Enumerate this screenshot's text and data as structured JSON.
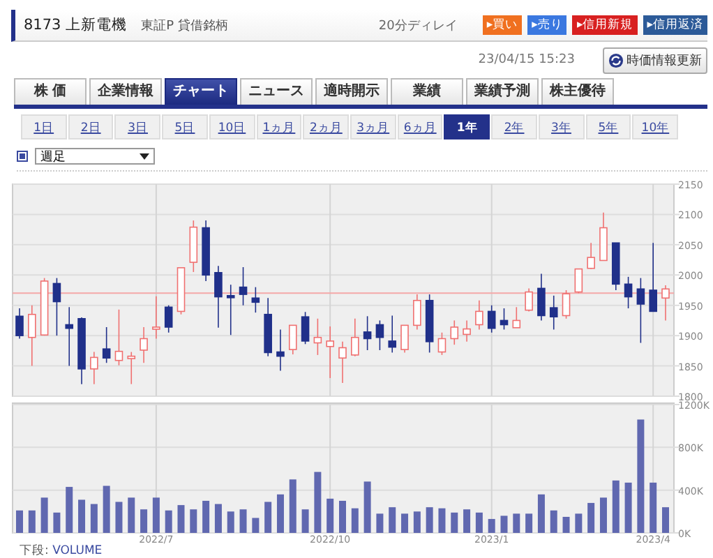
{
  "header": {
    "code": "8173",
    "name": "上新電機",
    "market": "東証P 貸借銘柄",
    "delay": "20分ディレイ",
    "buttons": [
      {
        "label": "▸買い",
        "color": "#f07020"
      },
      {
        "label": "▸売り",
        "color": "#3a78e0"
      },
      {
        "label": "▸信用新規",
        "color": "#d82020"
      },
      {
        "label": "▸信用返済",
        "color": "#2c5a98"
      }
    ]
  },
  "timestamp": "23/04/15 15:23",
  "refresh_button": "時価情報更新",
  "tabs": [
    {
      "label": "株 価",
      "selected": false
    },
    {
      "label": "企業情報",
      "selected": false
    },
    {
      "label": "チャート",
      "selected": true
    },
    {
      "label": "ニュース",
      "selected": false
    },
    {
      "label": "適時開示",
      "selected": false
    },
    {
      "label": "業績",
      "selected": false
    },
    {
      "label": "業績予測",
      "selected": false
    },
    {
      "label": "株主優待",
      "selected": false
    }
  ],
  "periods": [
    {
      "label": "1日",
      "selected": false
    },
    {
      "label": "2日",
      "selected": false
    },
    {
      "label": "3日",
      "selected": false
    },
    {
      "label": "5日",
      "selected": false
    },
    {
      "label": "10日",
      "selected": false
    },
    {
      "label": "1ヵ月",
      "selected": false
    },
    {
      "label": "2ヵ月",
      "selected": false
    },
    {
      "label": "3ヵ月",
      "selected": false
    },
    {
      "label": "6ヵ月",
      "selected": false
    },
    {
      "label": "1年",
      "selected": true
    },
    {
      "label": "2年",
      "selected": false
    },
    {
      "label": "3年",
      "selected": false
    },
    {
      "label": "5年",
      "selected": false
    },
    {
      "label": "10年",
      "selected": false
    }
  ],
  "interval_select": {
    "value": "週足"
  },
  "price_chart": {
    "chart_data": {
      "type": "candlestick",
      "grid": true,
      "ylim": [
        1800,
        2150
      ],
      "yticks": [
        1800,
        1850,
        1900,
        1950,
        2000,
        2050,
        2100,
        2150
      ],
      "ref_lines": [
        {
          "axis": "y",
          "value": 1970,
          "color": "#f4a8a8"
        }
      ],
      "categories": [
        null,
        null,
        null,
        null,
        null,
        null,
        null,
        null,
        null,
        null,
        null,
        null,
        null,
        null,
        null,
        null,
        null,
        null,
        null,
        null,
        null,
        null,
        null,
        null,
        null,
        null,
        null,
        null,
        null,
        null,
        null,
        null,
        null,
        null,
        null,
        null,
        null,
        null,
        null,
        null,
        null,
        null,
        null,
        null,
        null,
        null,
        null,
        null,
        null,
        null,
        null,
        null,
        null
      ],
      "ohlc": [
        [
          1932,
          1945,
          1895,
          1900
        ],
        [
          1897,
          1950,
          1850,
          1935
        ],
        [
          1901,
          1995,
          1900,
          1990
        ],
        [
          1986,
          1995,
          1900,
          1956
        ],
        [
          1918,
          1947,
          1850,
          1912
        ],
        [
          1928,
          1930,
          1820,
          1845
        ],
        [
          1845,
          1873,
          1820,
          1864
        ],
        [
          1878,
          1914,
          1855,
          1863
        ],
        [
          1859,
          1943,
          1851,
          1874
        ],
        [
          1862,
          1873,
          1820,
          1866
        ],
        [
          1876,
          1914,
          1855,
          1895
        ],
        [
          1912,
          1965,
          1895,
          1914
        ],
        [
          1947,
          1950,
          1905,
          1914
        ],
        [
          1940,
          2012,
          1935,
          2012
        ],
        [
          2021,
          2090,
          2005,
          2079
        ],
        [
          2078,
          2090,
          1990,
          2000
        ],
        [
          2004,
          2015,
          1913,
          1964
        ],
        [
          1966,
          1984,
          1901,
          1964
        ],
        [
          1980,
          2013,
          1950,
          1968
        ],
        [
          1962,
          1980,
          1938,
          1955
        ],
        [
          1935,
          1962,
          1866,
          1872
        ],
        [
          1873,
          1910,
          1842,
          1866
        ],
        [
          1877,
          1917,
          1869,
          1917
        ],
        [
          1931,
          1939,
          1886,
          1891
        ],
        [
          1888,
          1928,
          1868,
          1897
        ],
        [
          1882,
          1915,
          1830,
          1891
        ],
        [
          1863,
          1890,
          1822,
          1880
        ],
        [
          1868,
          1928,
          1866,
          1897
        ],
        [
          1906,
          1932,
          1876,
          1895
        ],
        [
          1918,
          1925,
          1876,
          1897
        ],
        [
          1891,
          1933,
          1872,
          1881
        ],
        [
          1877,
          1917,
          1872,
          1917
        ],
        [
          1917,
          1968,
          1910,
          1958
        ],
        [
          1958,
          1968,
          1872,
          1890
        ],
        [
          1873,
          1905,
          1868,
          1895
        ],
        [
          1895,
          1925,
          1885,
          1914
        ],
        [
          1902,
          1925,
          1890,
          1911
        ],
        [
          1918,
          1958,
          1910,
          1940
        ],
        [
          1940,
          1950,
          1905,
          1912
        ],
        [
          1925,
          1945,
          1910,
          1918
        ],
        [
          1913,
          1947,
          1913,
          1925
        ],
        [
          1942,
          1978,
          1940,
          1972
        ],
        [
          1978,
          2002,
          1925,
          1933
        ],
        [
          1946,
          1966,
          1910,
          1931
        ],
        [
          1933,
          1975,
          1928,
          1969
        ],
        [
          1972,
          2010,
          1970,
          2010
        ],
        [
          2011,
          2053,
          2010,
          2029
        ],
        [
          2024,
          2103,
          2024,
          2078
        ],
        [
          2053,
          2053,
          1975,
          1985
        ],
        [
          1985,
          1997,
          1945,
          1964
        ],
        [
          1977,
          1995,
          1888,
          1952
        ],
        [
          1975,
          2053,
          1940,
          1940
        ],
        [
          1962,
          1983,
          1925,
          1977
        ]
      ]
    }
  },
  "volume_chart": {
    "chart_data": {
      "type": "bar",
      "grid": true,
      "ylim": [
        0,
        1200
      ],
      "yticks": [
        {
          "value": 0,
          "label": "0K"
        },
        {
          "value": 400,
          "label": "400K"
        },
        {
          "value": 800,
          "label": "800K"
        },
        {
          "value": 1200,
          "label": "1200K"
        }
      ],
      "categories": [
        null,
        null,
        null,
        null,
        null,
        null,
        null,
        null,
        null,
        null,
        null,
        "2022/7",
        null,
        null,
        null,
        null,
        null,
        null,
        null,
        null,
        null,
        null,
        null,
        null,
        null,
        "2022/10",
        null,
        null,
        null,
        null,
        null,
        null,
        null,
        null,
        null,
        null,
        null,
        null,
        "2023/1",
        null,
        null,
        null,
        null,
        null,
        null,
        null,
        null,
        null,
        null,
        null,
        null,
        "2023/4",
        null
      ],
      "series": [
        {
          "name": "VOLUME",
          "color": "#6068b0",
          "values": [
            210,
            210,
            330,
            190,
            430,
            310,
            270,
            440,
            290,
            330,
            220,
            330,
            210,
            260,
            220,
            300,
            270,
            200,
            220,
            140,
            290,
            360,
            500,
            220,
            570,
            320,
            300,
            230,
            480,
            180,
            240,
            180,
            200,
            240,
            230,
            190,
            220,
            190,
            130,
            160,
            180,
            180,
            360,
            210,
            150,
            180,
            280,
            330,
            490,
            470,
            1060,
            470,
            240
          ]
        }
      ]
    }
  },
  "lower_caption": {
    "label": "下段:"
  }
}
